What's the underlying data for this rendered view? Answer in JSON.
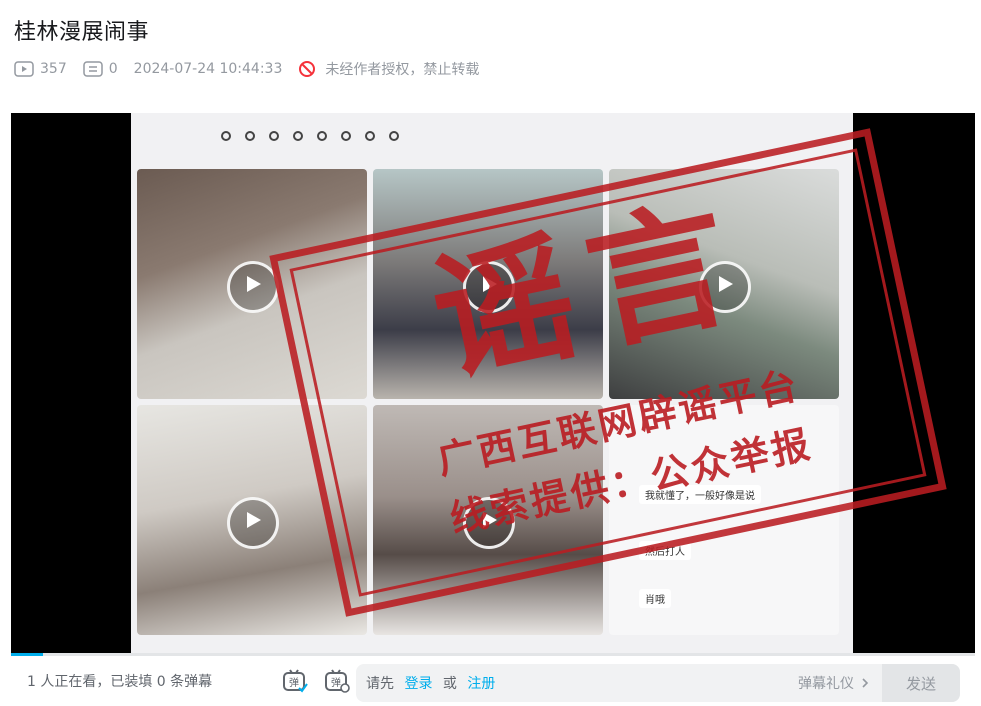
{
  "video": {
    "title": "桂林漫展闹事",
    "views": "357",
    "danmaku_count": "0",
    "datetime": "2024-07-24 10:44:33",
    "copyright_notice": "未经作者授权，禁止转载"
  },
  "player": {
    "stamp_main": "谣言",
    "stamp_line1": "广西互联网辟谣平台",
    "stamp_line2": "线索提供：公众举报",
    "chat_lines": [
      "我就懂了，一般好像是说",
      "然后打人",
      "肖哦"
    ],
    "progress_fraction": 0.033
  },
  "bottom_bar": {
    "viewers_text": "1 人正在看，已装填 0 条弹幕",
    "input_prefix": "请先",
    "login_link": "登录",
    "or_text": "或",
    "register_link": "注册",
    "etiquette_label": "弹幕礼仪",
    "send_button": "发送"
  },
  "icons": [
    "play-count-icon",
    "danmaku-count-icon",
    "no-repost-icon",
    "danmaku-toggle-icon",
    "danmaku-settings-icon",
    "chevron-right-icon"
  ],
  "colors": {
    "accent": "#00aeec",
    "stamp_red": "#b91c21",
    "muted_text": "#9499a0"
  }
}
